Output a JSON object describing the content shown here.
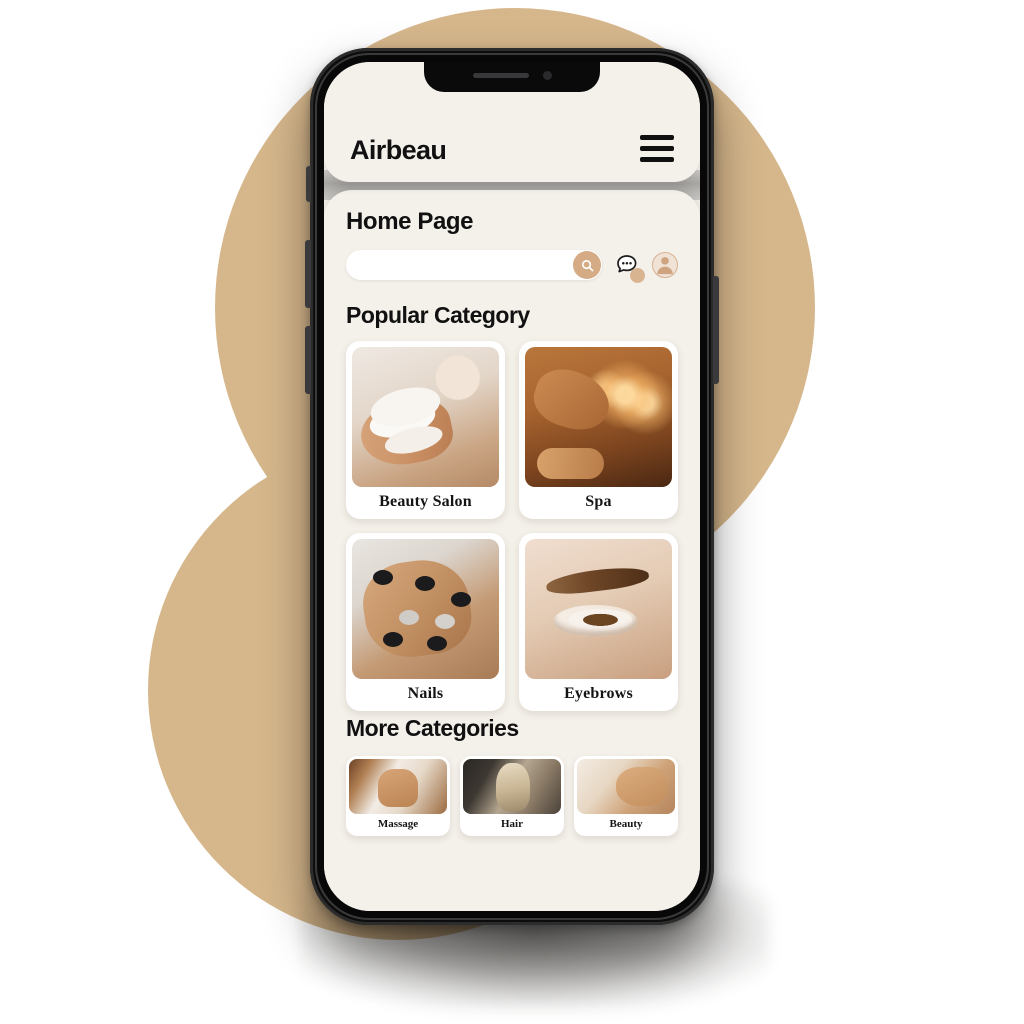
{
  "app": {
    "brand": "Airbeau",
    "menu_icon": "hamburger-menu-icon"
  },
  "page": {
    "title": "Home Page"
  },
  "search": {
    "value": "",
    "placeholder": "",
    "search_icon": "magnifier-icon"
  },
  "actions": {
    "chat_icon": "chat-bubble-icon",
    "chat_badge": "",
    "profile_icon": "user-avatar-icon"
  },
  "sections": {
    "popular_title": "Popular Category",
    "more_title": "More Categories"
  },
  "popular_categories": [
    {
      "label": "Beauty Salon",
      "image": "facial-mask-treatment"
    },
    {
      "label": "Spa",
      "image": "spa-candles-massage"
    },
    {
      "label": "Nails",
      "image": "manicured-hands"
    },
    {
      "label": "Eyebrows",
      "image": "eye-closeup-lashes"
    }
  ],
  "more_categories": [
    {
      "label": "Massage",
      "image": "back-massage"
    },
    {
      "label": "Hair",
      "image": "hair-styling-salon"
    },
    {
      "label": "Beauty",
      "image": "facial-beauty-treatment"
    }
  ],
  "colors": {
    "background_blob": "#d6b78c",
    "screen_background": "#f4f0ea",
    "card_background": "#ffffff",
    "accent_tan": "#d4ab85",
    "badge_tan": "#d9b491",
    "text_dark": "#111111",
    "phone_body": "#0d0d0d"
  }
}
